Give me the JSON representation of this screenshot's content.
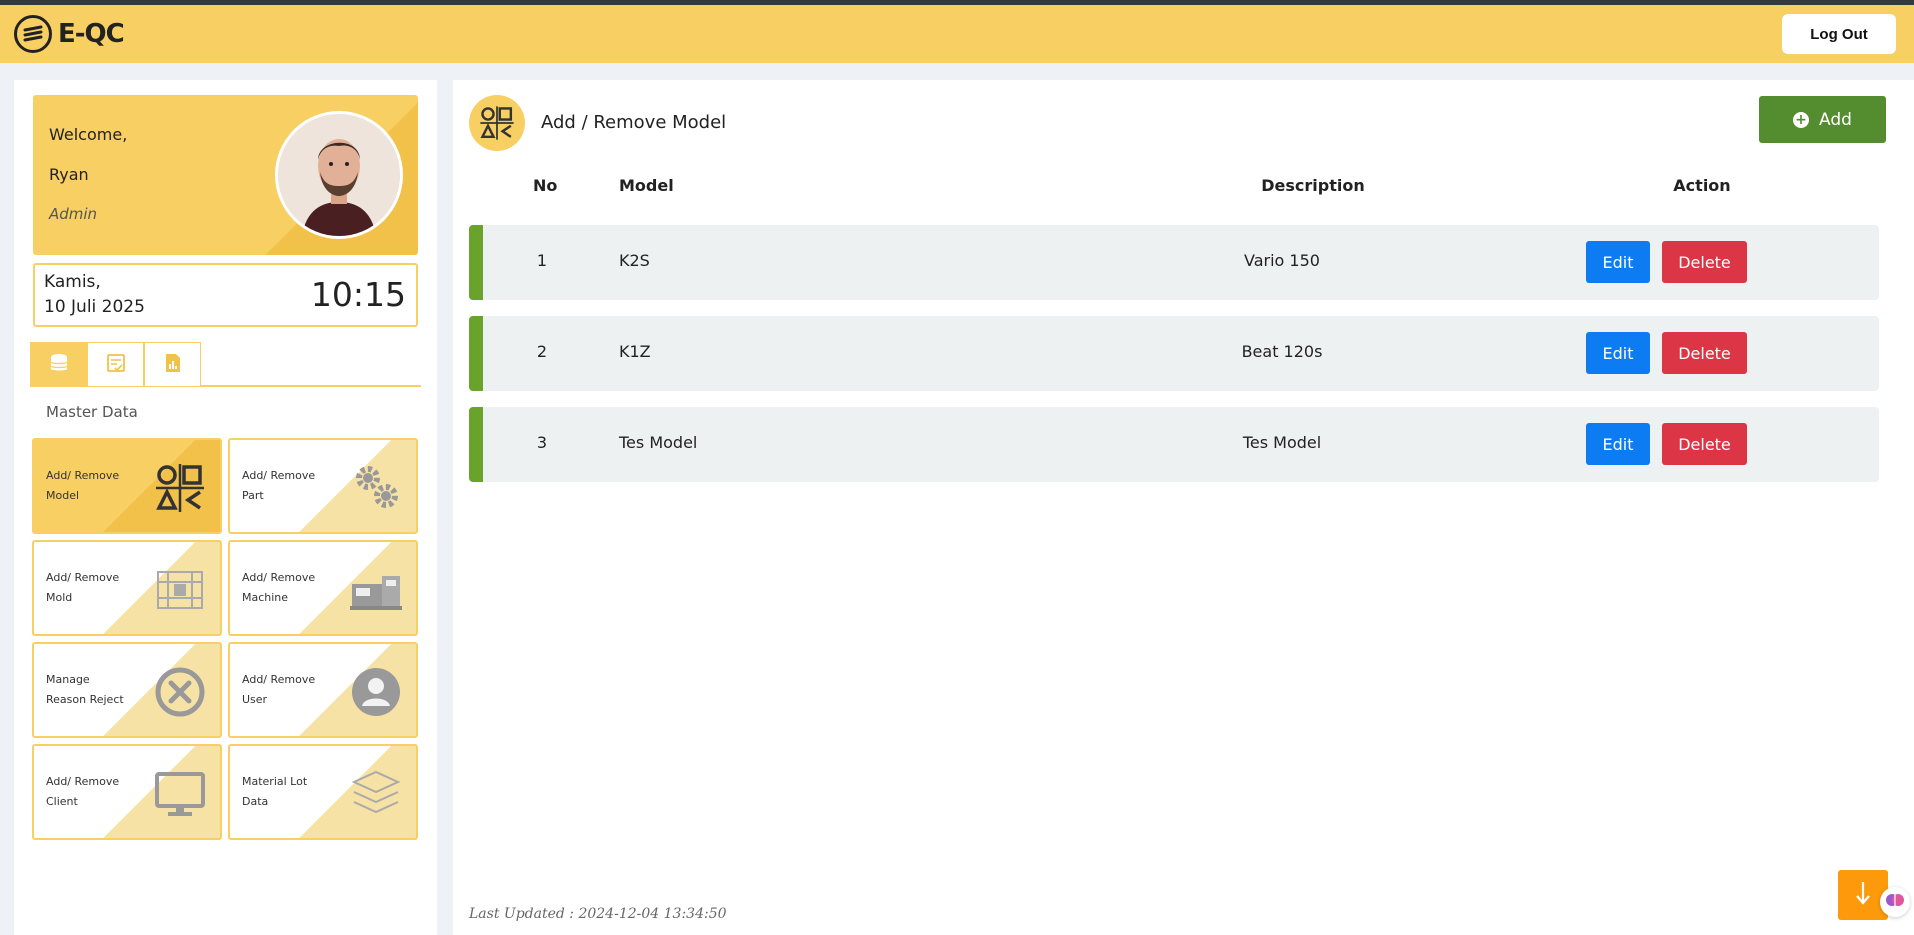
{
  "app": {
    "name": "E-QC",
    "logout_label": "Log Out"
  },
  "colors": {
    "accent": "#f8cf63",
    "add_button": "#548d2f",
    "edit_button": "#0d7cf2",
    "delete_button": "#dc3545",
    "row_marker": "#6aa32c",
    "scroll_button": "#fd9a0b"
  },
  "profile": {
    "greeting": "Welcome,",
    "name": "Ryan",
    "role": "Admin"
  },
  "datetime": {
    "day": "Kamis,",
    "date": "10 Juli 2025",
    "time": "10:15"
  },
  "tabs": [
    {
      "icon": "database-icon",
      "active": true
    },
    {
      "icon": "checklist-icon",
      "active": false
    },
    {
      "icon": "report-icon",
      "active": false
    }
  ],
  "sidebar": {
    "section_title": "Master Data",
    "tiles": [
      {
        "line1": "Add/ Remove",
        "line2": "Model",
        "icon": "model-shapes-icon"
      },
      {
        "line1": "Add/ Remove",
        "line2": "Part",
        "icon": "gears-icon"
      },
      {
        "line1": "Add/ Remove",
        "line2": "Mold",
        "icon": "mold-icon"
      },
      {
        "line1": "Add/ Remove",
        "line2": "Machine",
        "icon": "machine-icon"
      },
      {
        "line1": "Manage",
        "line2": "Reason Reject",
        "icon": "reject-icon"
      },
      {
        "line1": "Add/ Remove",
        "line2": "User",
        "icon": "user-icon"
      },
      {
        "line1": "Add/ Remove",
        "line2": "Client",
        "icon": "monitor-icon"
      },
      {
        "line1": "Material Lot",
        "line2": "Data",
        "icon": "layers-icon"
      }
    ]
  },
  "main": {
    "title": "Add / Remove Model",
    "add_label": "Add",
    "columns": {
      "no": "No",
      "model": "Model",
      "description": "Description",
      "action": "Action"
    },
    "rows": [
      {
        "no": "1",
        "model": "K2S",
        "description": "Vario 150"
      },
      {
        "no": "2",
        "model": "K1Z",
        "description": "Beat 120s"
      },
      {
        "no": "3",
        "model": "Tes Model",
        "description": "Tes Model"
      }
    ],
    "edit_label": "Edit",
    "delete_label": "Delete",
    "last_updated": "Last Updated : 2024-12-04 13:34:50"
  }
}
